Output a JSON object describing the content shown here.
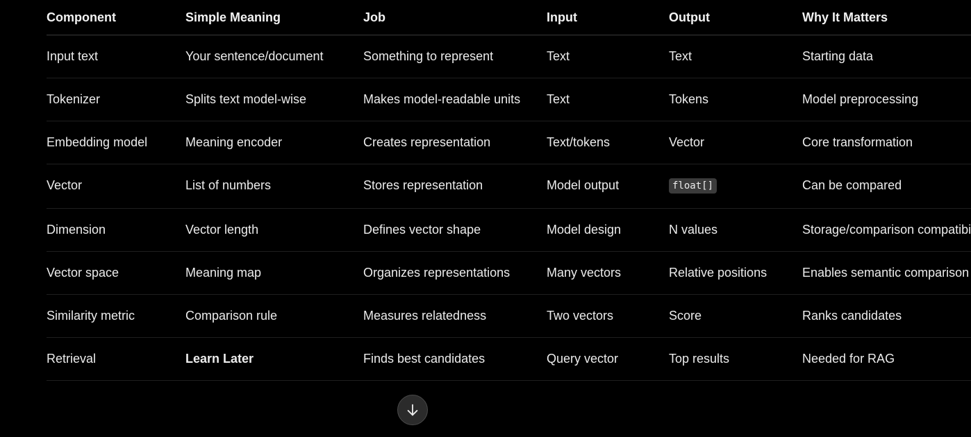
{
  "table": {
    "headers": [
      "Component",
      "Simple Meaning",
      "Job",
      "Input",
      "Output",
      "Why It Matters"
    ],
    "rows": [
      [
        "Input text",
        "Your sentence/document",
        "Something to represent",
        "Text",
        "Text",
        "Starting data"
      ],
      [
        "Tokenizer",
        "Splits text model-wise",
        "Makes model-readable units",
        "Text",
        "Tokens",
        "Model preprocessing"
      ],
      [
        "Embedding model",
        "Meaning encoder",
        "Creates representation",
        "Text/tokens",
        "Vector",
        "Core transformation"
      ],
      [
        "Vector",
        "List of numbers",
        "Stores representation",
        "Model output",
        "float[]",
        "Can be compared"
      ],
      [
        "Dimension",
        "Vector length",
        "Defines vector shape",
        "Model design",
        "N values",
        "Storage/comparison compatibility"
      ],
      [
        "Vector space",
        "Meaning map",
        "Organizes representations",
        "Many vectors",
        "Relative positions",
        "Enables semantic comparison"
      ],
      [
        "Similarity metric",
        "Comparison rule",
        "Measures relatedness",
        "Two vectors",
        "Score",
        "Ranks candidates"
      ],
      [
        "Retrieval",
        "Learn Later",
        "Finds best candidates",
        "Query vector",
        "Top results",
        "Needed for RAG"
      ]
    ]
  },
  "scroll_button": {
    "icon": "arrow-down-icon"
  }
}
